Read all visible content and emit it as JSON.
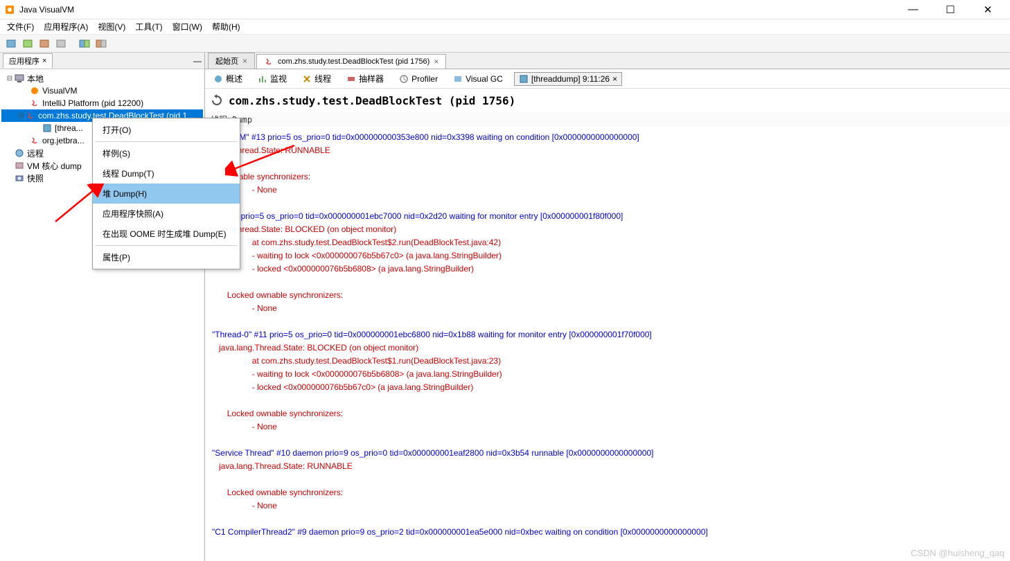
{
  "window": {
    "title": "Java VisualVM"
  },
  "menubar": {
    "file": "文件(F)",
    "app": "应用程序(A)",
    "view": "视图(V)",
    "tools": "工具(T)",
    "window": "窗口(W)",
    "help": "帮助(H)"
  },
  "sidebar": {
    "tab_label": "应用程序",
    "tree": {
      "local": "本地",
      "visualvm": "VisualVM",
      "intellij": "IntelliJ Platform (pid 12200)",
      "deadblock": "com.zhs.study.test.DeadBlockTest (pid 1...",
      "threaddump_node": "[threa...",
      "jetbrains": "org.jetbra...",
      "remote": "远程",
      "vmdump": "VM 核心 dump",
      "snapshots": "快照"
    }
  },
  "content": {
    "tabs": {
      "start": "起始页",
      "main": "com.zhs.study.test.DeadBlockTest (pid 1756)"
    },
    "subtabs": {
      "overview": "概述",
      "monitor": "监视",
      "threads": "线程",
      "sampler": "抽样器",
      "profiler": "Profiler",
      "visualgc": "Visual GC",
      "threaddump": "[threaddump] 9:11:26"
    },
    "heading": "com.zhs.study.test.DeadBlockTest (pid 1756)",
    "section": "线程 Dump"
  },
  "context_menu": {
    "open": "打开(O)",
    "sample": "样例(S)",
    "thread_dump": "线程 Dump(T)",
    "heap_dump": "堆 Dump(H)",
    "app_snapshot": "应用程序快照(A)",
    "oome": "在出现 OOME 时生成堆 Dump(E)",
    "properties": "属性(P)"
  },
  "dump": {
    "l1": "yJavaVM\" #13 prio=5 os_prio=0 tid=0x000000000353e800 nid=0x3398 waiting on condition [0x0000000000000000]",
    "l2": ".lang.Thread.State: RUNNABLE",
    "l3": "ed ownable synchronizers:",
    "l4": "- None",
    "l5": "-1\" #12 prio=5 os_prio=0 tid=0x000000001ebc7000 nid=0x2d20 waiting for monitor entry [0x000000001f80f000]",
    "l6": ".lang.Thread.State: BLOCKED (on object monitor)",
    "l7": "at com.zhs.study.test.DeadBlockTest$2.run(DeadBlockTest.java:42)",
    "l8": "- waiting to lock <0x000000076b5b67c0> (a java.lang.StringBuilder)",
    "l9": "- locked <0x000000076b5b6808> (a java.lang.StringBuilder)",
    "l10": "Locked ownable synchronizers:",
    "l11": "- None",
    "l12": "\"Thread-0\" #11 prio=5 os_prio=0 tid=0x000000001ebc6800 nid=0x1b88 waiting for monitor entry [0x000000001f70f000]",
    "l13": "   java.lang.Thread.State: BLOCKED (on object monitor)",
    "l14": "at com.zhs.study.test.DeadBlockTest$1.run(DeadBlockTest.java:23)",
    "l15": "- waiting to lock <0x000000076b5b6808> (a java.lang.StringBuilder)",
    "l16": "- locked <0x000000076b5b67c0> (a java.lang.StringBuilder)",
    "l17": "Locked ownable synchronizers:",
    "l18": "- None",
    "l19": "\"Service Thread\" #10 daemon prio=9 os_prio=0 tid=0x000000001eaf2800 nid=0x3b54 runnable [0x0000000000000000]",
    "l20": "   java.lang.Thread.State: RUNNABLE",
    "l21": "Locked ownable synchronizers:",
    "l22": "- None",
    "l23": "\"C1 CompilerThread2\" #9 daemon prio=9 os_prio=2 tid=0x000000001ea5e000 nid=0xbec waiting on condition [0x0000000000000000]"
  },
  "watermark": "CSDN @huisheng_qaq"
}
